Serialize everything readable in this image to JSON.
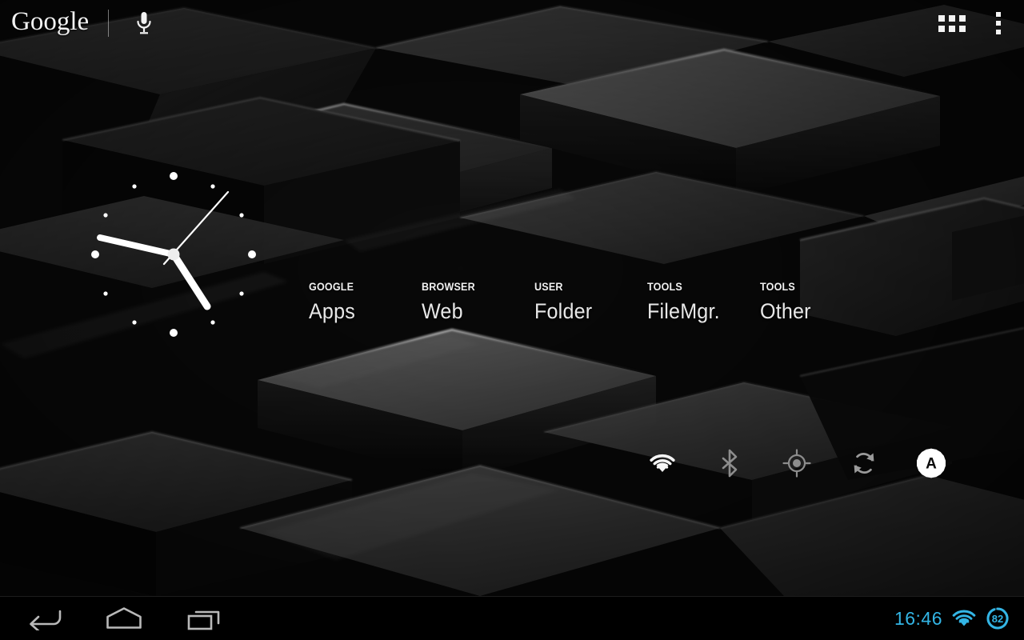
{
  "screen": {
    "device": "Android tablet home screen",
    "wallpaper_name": "dark-3d-cubes-wallpaper",
    "background_color": "#0a0a0a"
  },
  "search": {
    "logo_text": "Google",
    "mic_icon": "microphone-icon",
    "divider": "|"
  },
  "top_actions": {
    "apps_grid_icon": "apps-grid-icon",
    "apps_grid_label": "Apps",
    "overflow_icon": "overflow-menu-icon",
    "overflow_label": "Customize"
  },
  "clock_widget": {
    "name": "analog-clock-widget",
    "time_display": "4:47",
    "hour_hand_deg": 142,
    "minute_hand_deg": 281,
    "second_hand_deg": 37,
    "hand_color": "#ffffff",
    "marker_color": "#ffffff"
  },
  "shortcuts": [
    {
      "category": "GOOGLE",
      "name": "Apps"
    },
    {
      "category": "BROWSER",
      "name": "Web"
    },
    {
      "category": "USER",
      "name": "Folder"
    },
    {
      "category": "TOOLS",
      "name": "FileMgr."
    },
    {
      "category": "TOOLS",
      "name": "Other"
    }
  ],
  "power_widget": {
    "name": "power-control-widget",
    "buttons": [
      {
        "icon": "wifi-icon",
        "label": "Wi-Fi",
        "state": "on",
        "color": "#f5f5f5"
      },
      {
        "icon": "bluetooth-icon",
        "label": "Bluetooth",
        "state": "off",
        "color": "#8d8d8d"
      },
      {
        "icon": "gps-icon",
        "label": "GPS",
        "state": "off",
        "color": "#8d8d8d"
      },
      {
        "icon": "sync-icon",
        "label": "Sync",
        "state": "off",
        "color": "#9a9a9a"
      },
      {
        "icon": "brightness-icon",
        "label": "Auto brightness",
        "state": "auto",
        "color": "#ffffff",
        "badge": "A"
      }
    ]
  },
  "system_bar": {
    "nav": [
      {
        "icon": "back-icon",
        "label": "Back"
      },
      {
        "icon": "home-icon",
        "label": "Home"
      },
      {
        "icon": "recents-icon",
        "label": "Recent apps"
      }
    ],
    "clock": "16:46",
    "wifi_icon": "wifi-status-icon",
    "battery_icon": "battery-circle-icon",
    "battery_percent": "82",
    "accent_color": "#33b5e5"
  }
}
